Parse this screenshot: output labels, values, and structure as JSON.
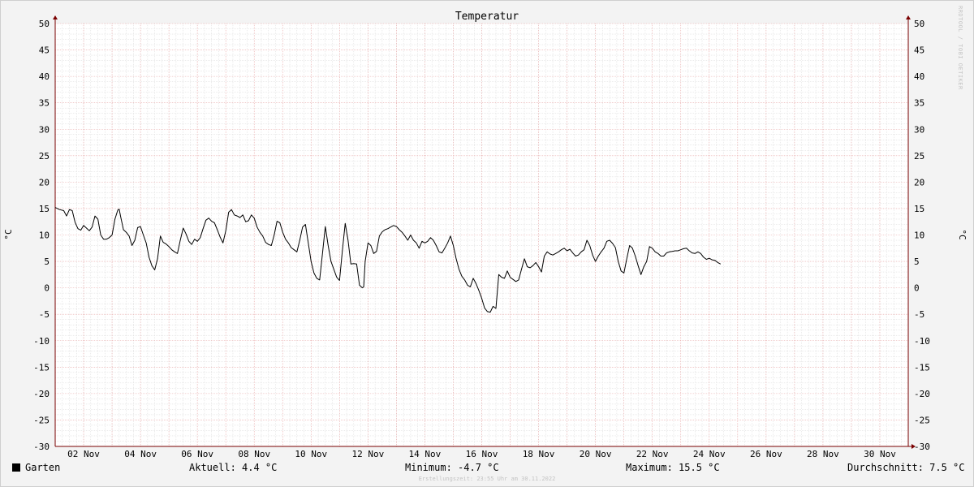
{
  "chart_data": {
    "type": "line",
    "title": "Temperatur",
    "ylabel_left": "°C",
    "ylabel_right": "°C",
    "ylim": [
      -30,
      50
    ],
    "y_ticks": [
      "50",
      "45",
      "40",
      "35",
      "30",
      "25",
      "20",
      "15",
      "10",
      "5",
      "0",
      "-5",
      "-10",
      "-15",
      "-20",
      "-25",
      "-30"
    ],
    "x_range_days": [
      1,
      31
    ],
    "x_ticks": [
      "02 Nov",
      "04 Nov",
      "06 Nov",
      "08 Nov",
      "10 Nov",
      "12 Nov",
      "14 Nov",
      "16 Nov",
      "18 Nov",
      "20 Nov",
      "22 Nov",
      "24 Nov",
      "26 Nov",
      "28 Nov",
      "30 Nov"
    ],
    "grid": true,
    "series": [
      {
        "name": "Garten",
        "color": "#000000",
        "points": [
          [
            1.0,
            15.2
          ],
          [
            1.15,
            14.8
          ],
          [
            1.3,
            14.6
          ],
          [
            1.4,
            13.6
          ],
          [
            1.5,
            14.8
          ],
          [
            1.6,
            14.6
          ],
          [
            1.7,
            12.4
          ],
          [
            1.8,
            11.2
          ],
          [
            1.9,
            10.9
          ],
          [
            2.0,
            11.8
          ],
          [
            2.1,
            11.3
          ],
          [
            2.2,
            10.8
          ],
          [
            2.3,
            11.5
          ],
          [
            2.4,
            13.6
          ],
          [
            2.5,
            13.0
          ],
          [
            2.6,
            10.0
          ],
          [
            2.7,
            9.2
          ],
          [
            2.8,
            9.2
          ],
          [
            2.9,
            9.5
          ],
          [
            3.0,
            10.0
          ],
          [
            3.1,
            13.0
          ],
          [
            3.2,
            14.7
          ],
          [
            3.25,
            14.9
          ],
          [
            3.3,
            13.5
          ],
          [
            3.4,
            11.0
          ],
          [
            3.5,
            10.5
          ],
          [
            3.6,
            9.8
          ],
          [
            3.7,
            8.0
          ],
          [
            3.8,
            9.0
          ],
          [
            3.9,
            11.4
          ],
          [
            4.0,
            11.6
          ],
          [
            4.1,
            10.0
          ],
          [
            4.2,
            8.5
          ],
          [
            4.3,
            5.8
          ],
          [
            4.4,
            4.2
          ],
          [
            4.5,
            3.4
          ],
          [
            4.6,
            5.5
          ],
          [
            4.7,
            9.8
          ],
          [
            4.8,
            8.6
          ],
          [
            4.9,
            8.3
          ],
          [
            5.0,
            7.8
          ],
          [
            5.1,
            7.2
          ],
          [
            5.2,
            6.8
          ],
          [
            5.3,
            6.5
          ],
          [
            5.4,
            9.0
          ],
          [
            5.5,
            11.3
          ],
          [
            5.6,
            10.2
          ],
          [
            5.7,
            8.8
          ],
          [
            5.8,
            8.2
          ],
          [
            5.9,
            9.2
          ],
          [
            6.0,
            8.8
          ],
          [
            6.1,
            9.5
          ],
          [
            6.2,
            11.2
          ],
          [
            6.3,
            12.8
          ],
          [
            6.4,
            13.2
          ],
          [
            6.5,
            12.6
          ],
          [
            6.6,
            12.3
          ],
          [
            6.7,
            11.0
          ],
          [
            6.8,
            9.6
          ],
          [
            6.9,
            8.5
          ],
          [
            7.0,
            10.8
          ],
          [
            7.1,
            14.3
          ],
          [
            7.2,
            14.8
          ],
          [
            7.3,
            13.8
          ],
          [
            7.4,
            13.6
          ],
          [
            7.5,
            13.3
          ],
          [
            7.6,
            13.8
          ],
          [
            7.7,
            12.5
          ],
          [
            7.8,
            12.7
          ],
          [
            7.9,
            13.8
          ],
          [
            8.0,
            13.2
          ],
          [
            8.1,
            11.5
          ],
          [
            8.2,
            10.5
          ],
          [
            8.3,
            9.8
          ],
          [
            8.4,
            8.6
          ],
          [
            8.5,
            8.2
          ],
          [
            8.6,
            8.0
          ],
          [
            8.7,
            10.0
          ],
          [
            8.8,
            12.6
          ],
          [
            8.9,
            12.3
          ],
          [
            9.0,
            10.5
          ],
          [
            9.1,
            9.2
          ],
          [
            9.2,
            8.5
          ],
          [
            9.3,
            7.6
          ],
          [
            9.4,
            7.2
          ],
          [
            9.5,
            6.8
          ],
          [
            9.6,
            9.0
          ],
          [
            9.7,
            11.5
          ],
          [
            9.8,
            12.0
          ],
          [
            9.9,
            8.5
          ],
          [
            10.0,
            5.0
          ],
          [
            10.1,
            2.8
          ],
          [
            10.2,
            1.8
          ],
          [
            10.3,
            1.5
          ],
          [
            10.4,
            6.5
          ],
          [
            10.5,
            11.6
          ],
          [
            10.6,
            8.0
          ],
          [
            10.7,
            5.0
          ],
          [
            10.8,
            3.5
          ],
          [
            10.9,
            2.0
          ],
          [
            11.0,
            1.4
          ],
          [
            11.1,
            7.0
          ],
          [
            11.2,
            12.2
          ],
          [
            11.3,
            9.0
          ],
          [
            11.4,
            4.5
          ],
          [
            11.5,
            4.6
          ],
          [
            11.6,
            4.5
          ],
          [
            11.7,
            0.5
          ],
          [
            11.8,
            0.0
          ],
          [
            11.85,
            0.2
          ],
          [
            11.9,
            5.0
          ],
          [
            12.0,
            8.5
          ],
          [
            12.1,
            8.0
          ],
          [
            12.2,
            6.5
          ],
          [
            12.3,
            6.9
          ],
          [
            12.4,
            9.8
          ],
          [
            12.5,
            10.6
          ],
          [
            12.6,
            11.0
          ],
          [
            12.7,
            11.2
          ],
          [
            12.8,
            11.5
          ],
          [
            12.9,
            11.8
          ],
          [
            13.0,
            11.6
          ],
          [
            13.1,
            11.0
          ],
          [
            13.2,
            10.5
          ],
          [
            13.3,
            9.8
          ],
          [
            13.4,
            9.0
          ],
          [
            13.5,
            10.0
          ],
          [
            13.6,
            9.0
          ],
          [
            13.7,
            8.5
          ],
          [
            13.8,
            7.5
          ],
          [
            13.9,
            8.8
          ],
          [
            14.0,
            8.5
          ],
          [
            14.1,
            8.8
          ],
          [
            14.2,
            9.5
          ],
          [
            14.3,
            9.0
          ],
          [
            14.4,
            8.0
          ],
          [
            14.5,
            6.8
          ],
          [
            14.6,
            6.6
          ],
          [
            14.7,
            7.5
          ],
          [
            14.8,
            8.5
          ],
          [
            14.9,
            9.8
          ],
          [
            15.0,
            8.0
          ],
          [
            15.1,
            5.5
          ],
          [
            15.2,
            3.5
          ],
          [
            15.3,
            2.2
          ],
          [
            15.4,
            1.5
          ],
          [
            15.5,
            0.5
          ],
          [
            15.6,
            0.2
          ],
          [
            15.7,
            1.8
          ],
          [
            15.8,
            0.8
          ],
          [
            15.9,
            -0.5
          ],
          [
            16.0,
            -2.0
          ],
          [
            16.1,
            -3.8
          ],
          [
            16.2,
            -4.5
          ],
          [
            16.3,
            -4.6
          ],
          [
            16.4,
            -3.5
          ],
          [
            16.5,
            -3.9
          ],
          [
            16.6,
            2.5
          ],
          [
            16.7,
            2.0
          ],
          [
            16.8,
            1.8
          ],
          [
            16.9,
            3.2
          ],
          [
            17.0,
            2.0
          ],
          [
            17.1,
            1.6
          ],
          [
            17.2,
            1.2
          ],
          [
            17.3,
            1.5
          ],
          [
            17.4,
            3.5
          ],
          [
            17.5,
            5.5
          ],
          [
            17.6,
            4.0
          ],
          [
            17.7,
            3.8
          ],
          [
            17.8,
            4.2
          ],
          [
            17.9,
            4.8
          ],
          [
            18.0,
            4.0
          ],
          [
            18.1,
            3.0
          ],
          [
            18.2,
            6.0
          ],
          [
            18.3,
            6.8
          ],
          [
            18.4,
            6.4
          ],
          [
            18.5,
            6.2
          ],
          [
            18.6,
            6.5
          ],
          [
            18.7,
            6.8
          ],
          [
            18.8,
            7.2
          ],
          [
            18.9,
            7.5
          ],
          [
            19.0,
            7.0
          ],
          [
            19.1,
            7.3
          ],
          [
            19.2,
            6.6
          ],
          [
            19.3,
            6.0
          ],
          [
            19.4,
            6.2
          ],
          [
            19.5,
            6.8
          ],
          [
            19.6,
            7.2
          ],
          [
            19.7,
            9.0
          ],
          [
            19.8,
            8.0
          ],
          [
            19.9,
            6.2
          ],
          [
            20.0,
            5.0
          ],
          [
            20.1,
            6.0
          ],
          [
            20.2,
            6.8
          ],
          [
            20.3,
            7.5
          ],
          [
            20.4,
            8.8
          ],
          [
            20.5,
            9.0
          ],
          [
            20.6,
            8.4
          ],
          [
            20.7,
            7.6
          ],
          [
            20.8,
            5.0
          ],
          [
            20.9,
            3.2
          ],
          [
            21.0,
            2.8
          ],
          [
            21.1,
            5.5
          ],
          [
            21.2,
            8.0
          ],
          [
            21.3,
            7.5
          ],
          [
            21.4,
            6.0
          ],
          [
            21.5,
            4.2
          ],
          [
            21.6,
            2.5
          ],
          [
            21.7,
            4.0
          ],
          [
            21.8,
            5.0
          ],
          [
            21.9,
            7.8
          ],
          [
            22.0,
            7.5
          ],
          [
            22.1,
            6.8
          ],
          [
            22.2,
            6.5
          ],
          [
            22.3,
            6.0
          ],
          [
            22.4,
            6.0
          ],
          [
            22.5,
            6.6
          ],
          [
            22.6,
            6.8
          ],
          [
            22.7,
            6.9
          ],
          [
            22.8,
            7.0
          ],
          [
            22.9,
            7.0
          ],
          [
            23.0,
            7.2
          ],
          [
            23.1,
            7.4
          ],
          [
            23.2,
            7.5
          ],
          [
            23.3,
            7.0
          ],
          [
            23.4,
            6.6
          ],
          [
            23.5,
            6.5
          ],
          [
            23.6,
            6.8
          ],
          [
            23.7,
            6.5
          ],
          [
            23.8,
            5.8
          ],
          [
            23.9,
            5.4
          ],
          [
            24.0,
            5.6
          ],
          [
            24.1,
            5.3
          ],
          [
            24.2,
            5.2
          ],
          [
            24.3,
            4.8
          ],
          [
            24.4,
            4.5
          ]
        ]
      }
    ]
  },
  "legend": {
    "series_name": "Garten",
    "current": "Aktuell: 4.4 °C",
    "minimum": "Minimum: -4.7 °C",
    "maximum": "Maximum: 15.5 °C",
    "average": "Durchschnitt: 7.5 °C"
  },
  "footer_text": "Erstellungszeit: 23:55 Uhr am 30.11.2022",
  "watermark": "RRDTOOL / TOBI OETIKER",
  "colors": {
    "plot_background": "#ffffff",
    "minor_grid": "#d8d8d8",
    "major_grid": "#e8a8a8",
    "axis": "#7a0000",
    "series": "#000000"
  }
}
